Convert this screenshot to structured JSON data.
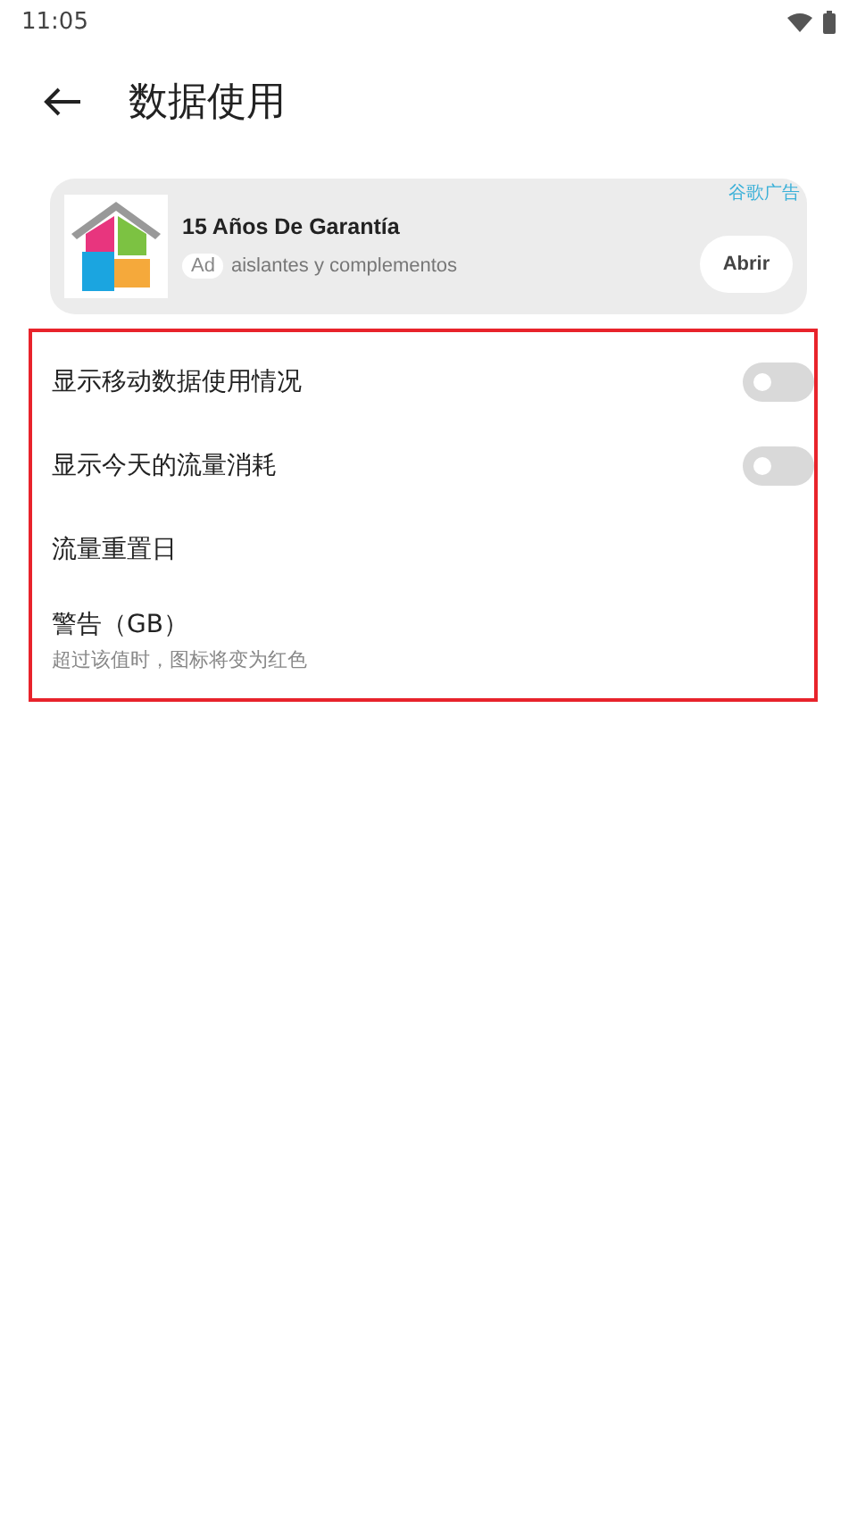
{
  "status_bar": {
    "time": "11:05"
  },
  "header": {
    "title": "数据使用"
  },
  "ad": {
    "label": "谷歌广告",
    "title": "15 Años De Garantía",
    "badge": "Ad",
    "subtitle": "aislantes y complementos",
    "button": "Abrir"
  },
  "settings": [
    {
      "kind": "toggle",
      "label": "显示移动数据使用情况",
      "on": false
    },
    {
      "kind": "toggle",
      "label": "显示今天的流量消耗",
      "on": false
    },
    {
      "kind": "plain",
      "label": "流量重置日"
    },
    {
      "kind": "plain",
      "label": "警告（GB）",
      "summary": "超过该值时，图标将变为红色"
    }
  ]
}
